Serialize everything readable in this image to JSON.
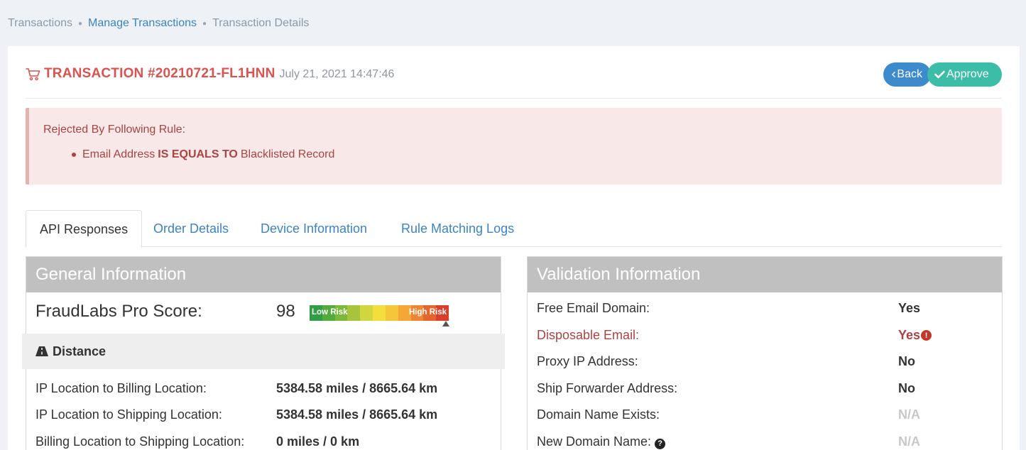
{
  "breadcrumb": {
    "items": [
      "Transactions",
      "Manage Transactions",
      "Transaction Details"
    ]
  },
  "header": {
    "title": "TRANSACTION #20210721-FL1HNN",
    "date": "July 21, 2021 14:47:46",
    "back_label": "Back",
    "approve_label": "Approve"
  },
  "alert": {
    "title": "Rejected By Following Rule:",
    "rule_field": "Email Address",
    "rule_operator": "IS EQUALS TO",
    "rule_value": "Blacklisted Record"
  },
  "tabs": [
    "API Responses",
    "Order Details",
    "Device Information",
    "Rule Matching Logs"
  ],
  "general": {
    "heading": "General Information",
    "score_label": "FraudLabs Pro Score:",
    "score_value": "98",
    "meter_low": "Low Risk",
    "meter_high": "High Risk",
    "distance_heading": "Distance",
    "rows": [
      {
        "label": "IP Location to Billing Location:",
        "value": "5384.58 miles / 8665.64 km"
      },
      {
        "label": "IP Location to Shipping Location:",
        "value": "5384.58 miles / 8665.64 km"
      },
      {
        "label": "Billing Location to Shipping Location:",
        "value": "0 miles / 0 km"
      }
    ]
  },
  "validation": {
    "heading": "Validation Information",
    "rows": [
      {
        "label": "Free Email Domain:",
        "value": "Yes"
      },
      {
        "label": "Disposable Email:",
        "value": "Yes"
      },
      {
        "label": "Proxy IP Address:",
        "value": "No"
      },
      {
        "label": "Ship Forwarder Address:",
        "value": "No"
      },
      {
        "label": "Domain Name Exists:",
        "value": "N/A"
      },
      {
        "label": "New Domain Name:",
        "value": "N/A"
      }
    ]
  },
  "colors": {
    "danger": "#d9534f",
    "primary": "#3d8bcd",
    "success": "#3bbda8"
  }
}
